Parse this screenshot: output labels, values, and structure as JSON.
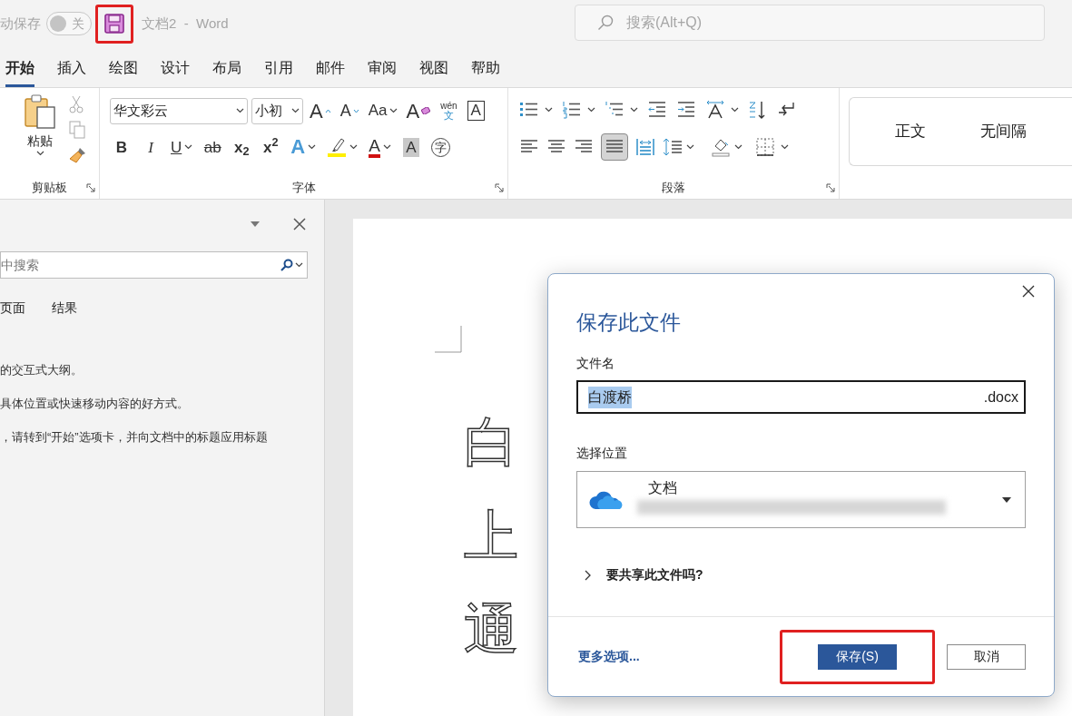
{
  "title_bar": {
    "autosave_label": "动保存",
    "autosave_toggle": {
      "label": "关",
      "on": false
    },
    "save_icon_highlighted": true,
    "document_title": "文档2  -  Word",
    "search": {
      "placeholder": "搜索(Alt+Q)"
    }
  },
  "ribbon_tabs": [
    {
      "label": "开始",
      "selected": true
    },
    {
      "label": "插入",
      "selected": false
    },
    {
      "label": "绘图",
      "selected": false
    },
    {
      "label": "设计",
      "selected": false
    },
    {
      "label": "布局",
      "selected": false
    },
    {
      "label": "引用",
      "selected": false
    },
    {
      "label": "邮件",
      "selected": false
    },
    {
      "label": "审阅",
      "selected": false
    },
    {
      "label": "视图",
      "selected": false
    },
    {
      "label": "帮助",
      "selected": false
    }
  ],
  "clipboard": {
    "title": "剪贴板",
    "paste_label": "粘贴"
  },
  "font": {
    "title": "字体",
    "font_name": "华文彩云",
    "font_size": "小初",
    "row1": [
      {
        "kind": "grow",
        "label": "A"
      },
      {
        "kind": "shrink",
        "label": "A"
      },
      {
        "kind": "case",
        "label": "Aa"
      },
      {
        "kind": "clear",
        "label": "A"
      },
      {
        "kind": "phonetic",
        "label": "wén",
        "sub": "文"
      },
      {
        "kind": "border",
        "label": "A"
      }
    ],
    "row2": [
      {
        "kind": "bold",
        "label": "B"
      },
      {
        "kind": "italic",
        "label": "I"
      },
      {
        "kind": "underline",
        "label": "U"
      },
      {
        "kind": "strike",
        "label": "ab"
      },
      {
        "kind": "script",
        "label": "x$_{2}$"
      },
      {
        "kind": "script",
        "label": "x$^{2}$"
      },
      {
        "kind": "effects",
        "label": "A"
      },
      {
        "kind": "highlight"
      },
      {
        "kind": "color",
        "label": "A"
      },
      {
        "kind": "shading",
        "label": "A"
      },
      {
        "kind": "enclose",
        "label": "字"
      }
    ]
  },
  "paragraph": {
    "title": "段落",
    "justify_selected": true
  },
  "styles": [
    "正文",
    "无间隔"
  ],
  "nav_pane": {
    "search_placeholder": "中搜索",
    "tabs": [
      {
        "label": "页面",
        "selected": false
      },
      {
        "label": "结果",
        "selected": false
      }
    ],
    "messages": [
      "的交互式大纲。",
      "具体位置或快速移动内容的好方式。",
      "，请转到“开始”选项卡，并向文档中的标题应用标题"
    ]
  },
  "document": {
    "visible_characters": [
      "白",
      "上",
      "通"
    ]
  },
  "dialog": {
    "title": "保存此文件",
    "filename_label": "文件名",
    "filename": {
      "value": "白渡桥",
      "extension": ".docx",
      "text_selected": true
    },
    "location_label": "选择位置",
    "location": {
      "name": "文档"
    },
    "share": {
      "label": "要共享此文件吗?",
      "expanded": false
    },
    "more_options": "更多选项...",
    "buttons": [
      {
        "kind": "primary",
        "label": "保存(S)",
        "highlighted": true
      },
      {
        "kind": "secondary",
        "label": "取消",
        "highlighted": false
      }
    ]
  }
}
